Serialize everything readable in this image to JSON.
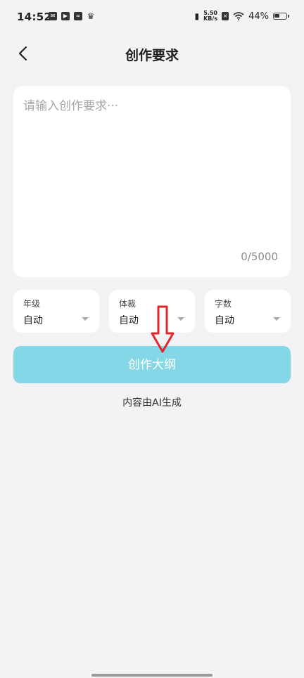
{
  "status_bar": {
    "time": "14:52",
    "net_speed_value": "5.50",
    "net_speed_unit": "KB/s",
    "battery_percent": "44%"
  },
  "nav": {
    "title": "创作要求"
  },
  "requirement": {
    "placeholder": "请输入创作要求···",
    "value": "",
    "counter": "0/5000"
  },
  "selectors": [
    {
      "label": "年级",
      "value": "自动"
    },
    {
      "label": "体裁",
      "value": "自动"
    },
    {
      "label": "字数",
      "value": "自动"
    }
  ],
  "generate_button": {
    "label": "创作大纲",
    "color": "#84d7e7"
  },
  "ai_note": "内容由AI生成",
  "annotation": {
    "arrow_color": "#e0262b"
  }
}
